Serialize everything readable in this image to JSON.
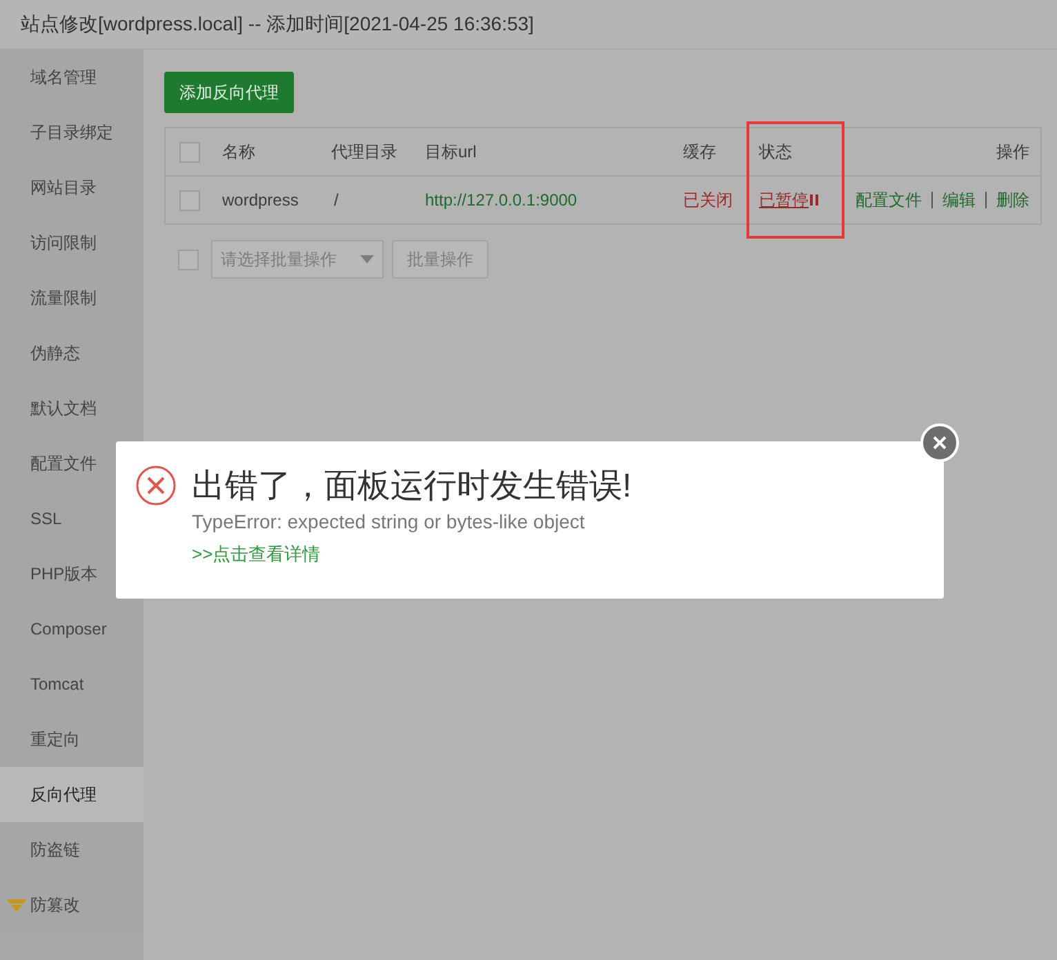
{
  "window": {
    "title": "站点修改[wordpress.local] -- 添加时间[2021-04-25 16:36:53]"
  },
  "sidebar": {
    "items": [
      {
        "label": "域名管理",
        "selected": false
      },
      {
        "label": "子目录绑定",
        "selected": false
      },
      {
        "label": "网站目录",
        "selected": false
      },
      {
        "label": "访问限制",
        "selected": false
      },
      {
        "label": "流量限制",
        "selected": false
      },
      {
        "label": "伪静态",
        "selected": false
      },
      {
        "label": "默认文档",
        "selected": false
      },
      {
        "label": "配置文件",
        "selected": false
      },
      {
        "label": "SSL",
        "selected": false
      },
      {
        "label": "PHP版本",
        "selected": false
      },
      {
        "label": "Composer",
        "selected": false
      },
      {
        "label": "Tomcat",
        "selected": false
      },
      {
        "label": "重定向",
        "selected": false
      },
      {
        "label": "反向代理",
        "selected": true
      },
      {
        "label": "防盗链",
        "selected": false
      },
      {
        "label": "防篡改",
        "selected": false,
        "premium": true
      }
    ]
  },
  "add_button": "添加反向代理",
  "table": {
    "all_checked": false,
    "columns": [
      "名称",
      "代理目录",
      "目标url",
      "缓存",
      "状态",
      "操作"
    ],
    "rows": [
      {
        "checked": false,
        "name": "wordpress",
        "dir": "/",
        "url": "http://127.0.0.1:9000",
        "cache": "已关闭",
        "status": "已暂停",
        "paused": true,
        "actions": [
          "配置文件",
          "编辑",
          "删除"
        ]
      }
    ]
  },
  "batch": {
    "checked": false,
    "placeholder": "请选择批量操作",
    "button": "批量操作"
  },
  "dialog": {
    "title": "出错了，面板运行时发生错误!",
    "message": "TypeError: expected string or bytes-like object",
    "link": ">>点击查看详情"
  }
}
